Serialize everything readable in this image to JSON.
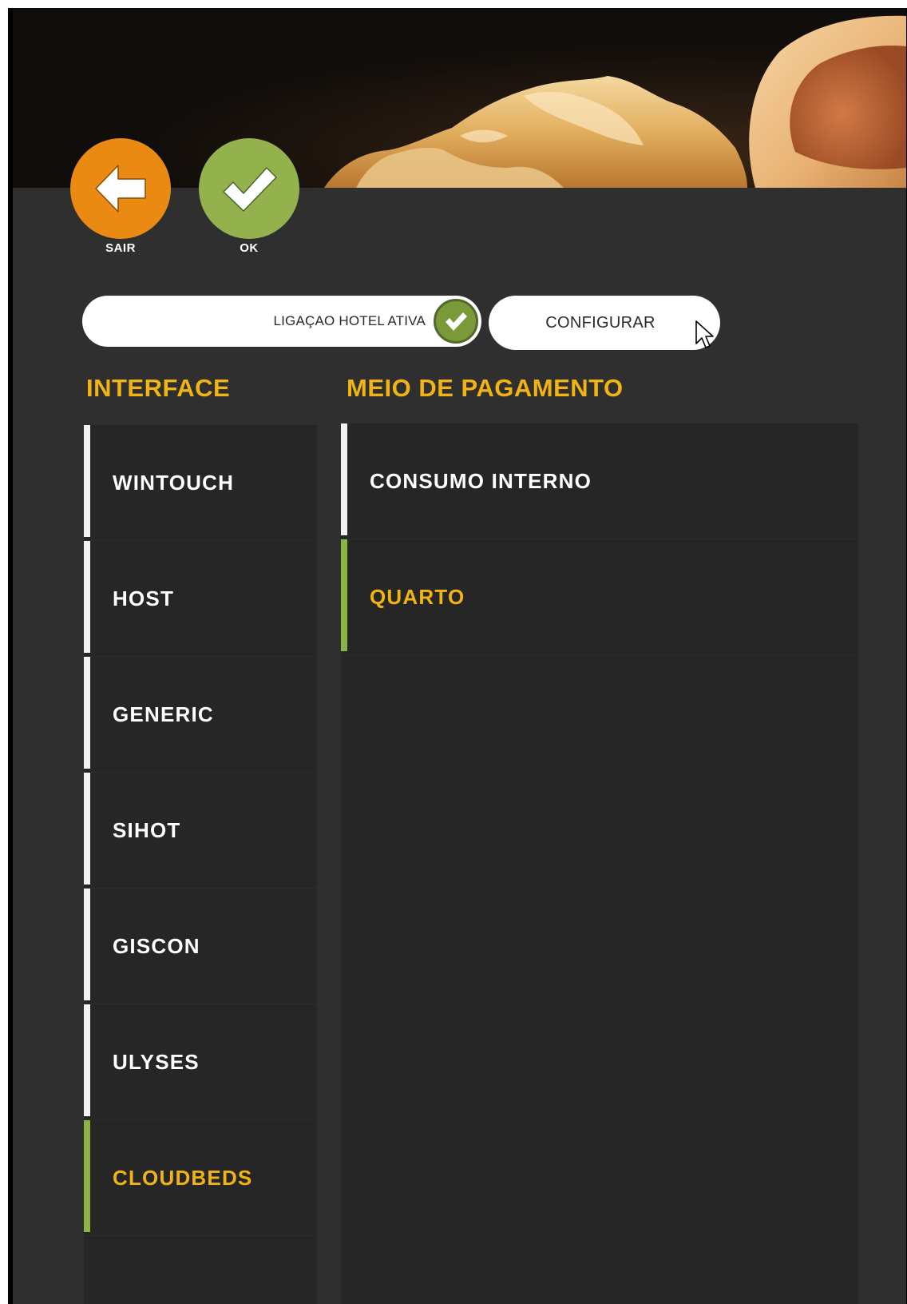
{
  "toolbar": {
    "back_label": "SAIR",
    "ok_label": "OK"
  },
  "status": {
    "text": "LIGAÇAO HOTEL ATIVA",
    "active": true
  },
  "configure": {
    "label": "CONFIGURAR"
  },
  "interface": {
    "title": "INTERFACE",
    "items": [
      {
        "label": "WINTOUCH",
        "selected": false
      },
      {
        "label": "HOST",
        "selected": false
      },
      {
        "label": "GENERIC",
        "selected": false
      },
      {
        "label": "SIHOT",
        "selected": false
      },
      {
        "label": "GISCON",
        "selected": false
      },
      {
        "label": "ULYSES",
        "selected": false
      },
      {
        "label": "CLOUDBEDS",
        "selected": true
      }
    ]
  },
  "payment": {
    "title": "MEIO DE PAGAMENTO",
    "items": [
      {
        "label": "CONSUMO INTERNO",
        "selected": false
      },
      {
        "label": "QUARTO",
        "selected": true
      }
    ]
  },
  "colors": {
    "accent_yellow": "#f1b413",
    "selected_green": "#8ab444",
    "back_orange": "#eb8a12",
    "ok_green": "#93b24d",
    "panel_bg": "#2f2f2f",
    "list_bg": "#262626"
  },
  "icons": {
    "back": "arrow-left-icon",
    "ok": "checkmark-icon",
    "status": "check-circle-icon",
    "cursor": "mouse-pointer-icon"
  }
}
